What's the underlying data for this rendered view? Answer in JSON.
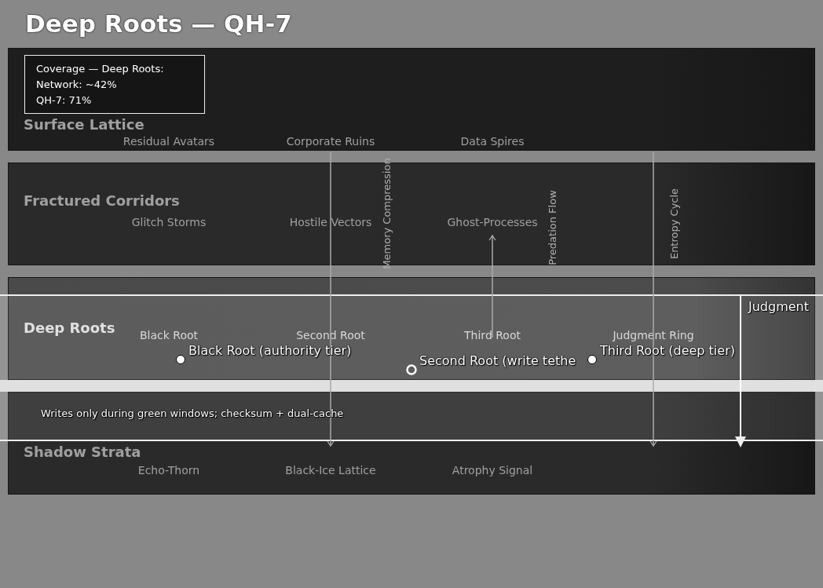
{
  "title": "Deep Roots — QH-7",
  "legend": {
    "lines": [
      "Coverage — Deep Roots:",
      "Network: ~42%",
      "QH-7: 71%"
    ]
  },
  "bands": [
    {
      "name": "Surface Lattice",
      "highlighted": false,
      "nodes": [
        "Residual Avatars",
        "Corporate Ruins",
        "Data Spires"
      ]
    },
    {
      "name": "Fractured Corridors",
      "highlighted": false,
      "nodes": [
        "Glitch Storms",
        "Hostile Vectors",
        "Ghost-Processes"
      ]
    },
    {
      "name": "Deep Roots",
      "highlighted": true,
      "nodes": [
        "Black Root",
        "Second Root",
        "Third Root",
        "Judgment Ring"
      ]
    },
    {
      "name": "Shadow Strata",
      "highlighted": false,
      "nodes": [
        "Echo-Thorn",
        "Black-Ice Lattice",
        "Atrophy Signal"
      ]
    }
  ],
  "flows": [
    {
      "label": "Memory Compression",
      "points_up": false
    },
    {
      "label": "Predation Flow",
      "points_up": true
    },
    {
      "label": "Entropy Cycle",
      "points_up": false
    }
  ],
  "markers": [
    {
      "label": "Black Root (authority tier)",
      "kind": "filled"
    },
    {
      "label": "Second Root (write tethe",
      "kind": "open"
    },
    {
      "label": "Third Root (deep tier)",
      "kind": "filled"
    }
  ],
  "tether": {
    "label": "Judgment"
  },
  "note": "Writes only during green windows; checksum + dual-cache"
}
